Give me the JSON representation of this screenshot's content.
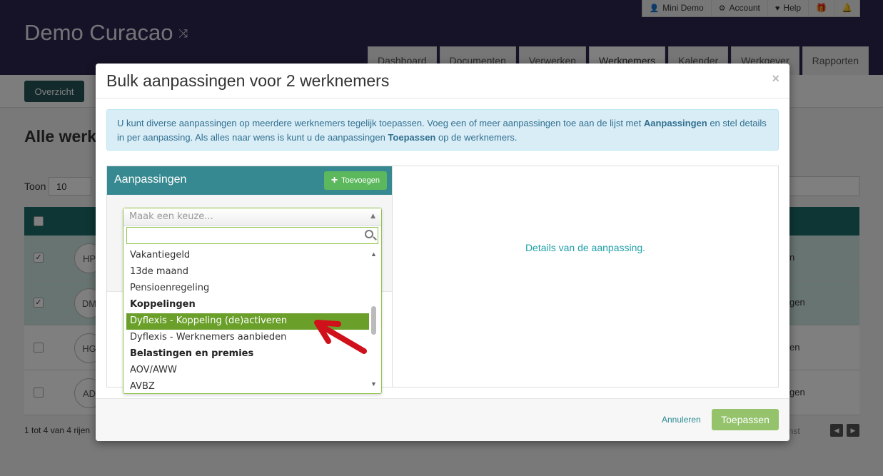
{
  "app": {
    "title": "Demo Curacao",
    "user_menu": [
      {
        "label": "Mini Demo",
        "icon": "user-icon"
      },
      {
        "label": "Account",
        "icon": "gear-icon"
      },
      {
        "label": "Help",
        "icon": "heart-icon"
      },
      {
        "label": "",
        "icon": "gift-icon"
      },
      {
        "label": "",
        "icon": "bell-icon"
      }
    ],
    "tabs": [
      "Dashboard",
      "Documenten",
      "Verwerken",
      "Werknemers",
      "Kalender",
      "Werkgever",
      "Rapporten"
    ],
    "active_tab": "Werknemers",
    "overview_button": "Overzicht",
    "page_heading": "Alle werk",
    "show_label": "Toon",
    "show_value": "10",
    "rows": [
      {
        "initials": "HP",
        "checked": true,
        "end_text": "n"
      },
      {
        "initials": "DM",
        "checked": true,
        "end_text": "gen"
      },
      {
        "initials": "HG",
        "checked": false,
        "end_text": "en"
      },
      {
        "initials": "AD",
        "checked": false,
        "end_text": "gen"
      }
    ],
    "footer_count": "1 tot 4 van 4 rijen",
    "pager_word": "enst"
  },
  "modal": {
    "title": "Bulk aanpassingen voor 2 werknemers",
    "close": "×",
    "info_part1": "U kunt diverse aanpassingen op meerdere werknemers tegelijk toepassen. Voeg een of meer aanpassingen toe aan de lijst met ",
    "info_bold1": "Aanpassingen",
    "info_part2": " en stel details in per aanpassing. Als alles naar wens is kunt u de aanpassingen ",
    "info_bold2": "Toepassen",
    "info_part3": " op de werknemers.",
    "left_panel_title": "Aanpassingen",
    "add_button": "Toevoegen",
    "select_placeholder": "Maak een keuze...",
    "search_value": "",
    "options": [
      {
        "label": "Vakantiegeld",
        "type": "option"
      },
      {
        "label": "13de maand",
        "type": "option"
      },
      {
        "label": "Pensioenregeling",
        "type": "option"
      },
      {
        "label": "Koppelingen",
        "type": "group"
      },
      {
        "label": "Dyflexis - Koppeling (de)activeren",
        "type": "option",
        "highlighted": true
      },
      {
        "label": "Dyflexis - Werknemers aanbieden",
        "type": "option"
      },
      {
        "label": "Belastingen en premies",
        "type": "group"
      },
      {
        "label": "AOV/AWW",
        "type": "option"
      },
      {
        "label": "AVBZ",
        "type": "option"
      }
    ],
    "details_placeholder": "Details van de aanpassing.",
    "cancel": "Annuleren",
    "apply": "Toepassen"
  },
  "colors": {
    "topbar": "#2d2650",
    "panel_header": "#378991",
    "highlight": "#6aa02a",
    "apply_button": "#94c36c",
    "annotation_arrow": "#d0101a"
  }
}
